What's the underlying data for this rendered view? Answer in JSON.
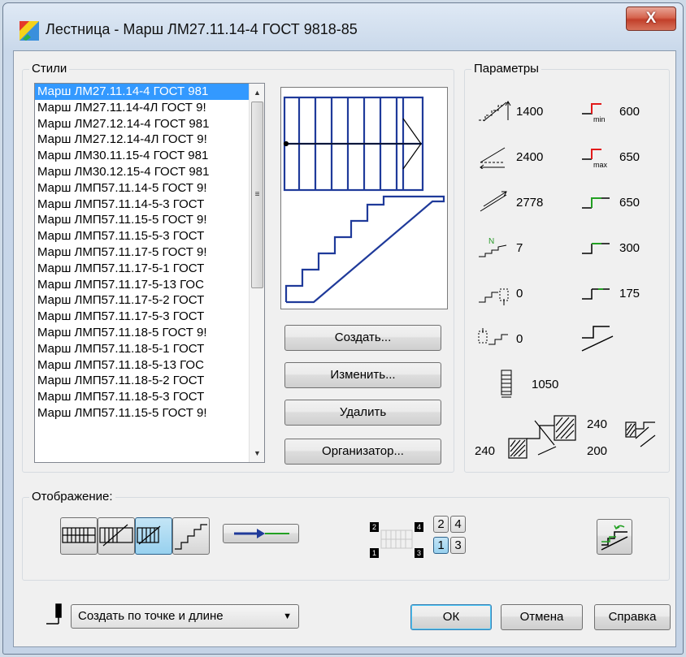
{
  "window": {
    "title": "Лестница - Марш ЛМ27.11.14-4 ГОСТ 9818-85",
    "close_label": "X"
  },
  "styles": {
    "group_label": "Стили",
    "items": [
      "Марш ЛМ27.11.14-4 ГОСТ 981",
      "Марш ЛМ27.11.14-4Л ГОСТ 9!",
      "Марш ЛМ27.12.14-4 ГОСТ 981",
      "Марш ЛМ27.12.14-4Л ГОСТ 9!",
      "Марш ЛМ30.11.15-4 ГОСТ 981",
      "Марш ЛМ30.12.15-4 ГОСТ 981",
      "Марш ЛМП57.11.14-5 ГОСТ 9!",
      "Марш ЛМП57.11.14-5-3 ГОСТ",
      "Марш ЛМП57.11.15-5 ГОСТ 9!",
      "Марш ЛМП57.11.15-5-3 ГОСТ",
      "Марш ЛМП57.11.17-5 ГОСТ 9!",
      "Марш ЛМП57.11.17-5-1 ГОСТ",
      "Марш ЛМП57.11.17-5-13 ГОС",
      "Марш ЛМП57.11.17-5-2 ГОСТ",
      "Марш ЛМП57.11.17-5-3 ГОСТ",
      "Марш ЛМП57.11.18-5 ГОСТ 9!",
      "Марш ЛМП57.11.18-5-1 ГОСТ",
      "Марш ЛМП57.11.18-5-13 ГОС",
      "Марш ЛМП57.11.18-5-2 ГОСТ",
      "Марш ЛМП57.11.18-5-3 ГОСТ",
      "Марш ЛМП57.11.15-5 ГОСТ 9!"
    ],
    "selected_index": 0
  },
  "buttons": {
    "create": "Создать...",
    "edit": "Изменить...",
    "delete": "Удалить",
    "organizer": "Организатор..."
  },
  "params": {
    "group_label": "Параметры",
    "height": "1400",
    "length": "2400",
    "march_length": "2778",
    "steps_count": "7",
    "bottom_offset": "0",
    "top_offset": "0",
    "width": "1050",
    "riser_min": "600",
    "riser_max": "650",
    "tread_1": "650",
    "tread_2": "300",
    "tread_3": "175",
    "support_left": "240",
    "support_right_top": "240",
    "support_right_bottom": "200"
  },
  "display": {
    "group_label": "Отображение:",
    "quadrant_labels": [
      "2",
      "4",
      "1",
      "3"
    ],
    "selected_quadrant": "1",
    "marker_labels": [
      "2",
      "4",
      "1",
      "3"
    ]
  },
  "bottom": {
    "creation_mode": "Создать по точке и длине",
    "ok": "ОК",
    "cancel": "Отмена",
    "help": "Справка"
  },
  "colors": {
    "accent_red": "#e21a1a",
    "accent_green": "#22a022",
    "selection": "#3399ff",
    "preview_blue": "#1f3a9a"
  }
}
